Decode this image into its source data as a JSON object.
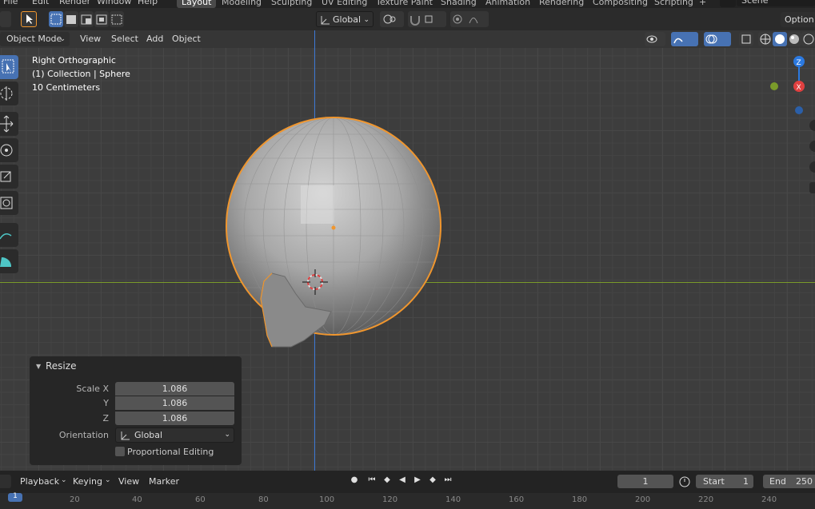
{
  "menus": [
    "File",
    "Edit",
    "Render",
    "Window",
    "Help"
  ],
  "workspaces": [
    "Layout",
    "Modeling",
    "Sculpting",
    "UV Editing",
    "Texture Paint",
    "Shading",
    "Animation",
    "Rendering",
    "Compositing",
    "Scripting"
  ],
  "active_workspace": "Layout",
  "scene": "Scene",
  "header": {
    "transform_orientation": "Global",
    "options": "Option"
  },
  "viewport_header": {
    "mode": "Object Mode",
    "menu": [
      "View",
      "Select",
      "Add",
      "Object"
    ]
  },
  "overlay_info": {
    "view": "Right Orthographic",
    "collection": "(1) Collection | Sphere",
    "scale": "10 Centimeters"
  },
  "gizmo": {
    "z_label": "Z",
    "x_label": "X"
  },
  "resize_panel": {
    "title": "Resize",
    "scale_x_label": "Scale X",
    "y_label": "Y",
    "z_label": "Z",
    "scale_x": "1.086",
    "scale_y": "1.086",
    "scale_z": "1.086",
    "orientation_label": "Orientation",
    "orientation_value": "Global",
    "proportional_label": "Proportional Editing",
    "proportional_checked": false
  },
  "timeline": {
    "menu": [
      "Playback",
      "Keying",
      "View",
      "Marker"
    ],
    "current_frame": "1",
    "start_label": "Start",
    "start": "1",
    "end_label": "End",
    "end": "250",
    "ruler_ticks": [
      "20",
      "40",
      "60",
      "80",
      "100",
      "120",
      "140",
      "160",
      "180",
      "200",
      "220",
      "240"
    ],
    "cursor_frame": "1"
  },
  "colors": {
    "accent": "#4772b3",
    "selection_outline": "#f0962e",
    "x_axis": "#e04040",
    "y_axis": "#7a9b2a",
    "z_axis": "#2b79e0"
  }
}
